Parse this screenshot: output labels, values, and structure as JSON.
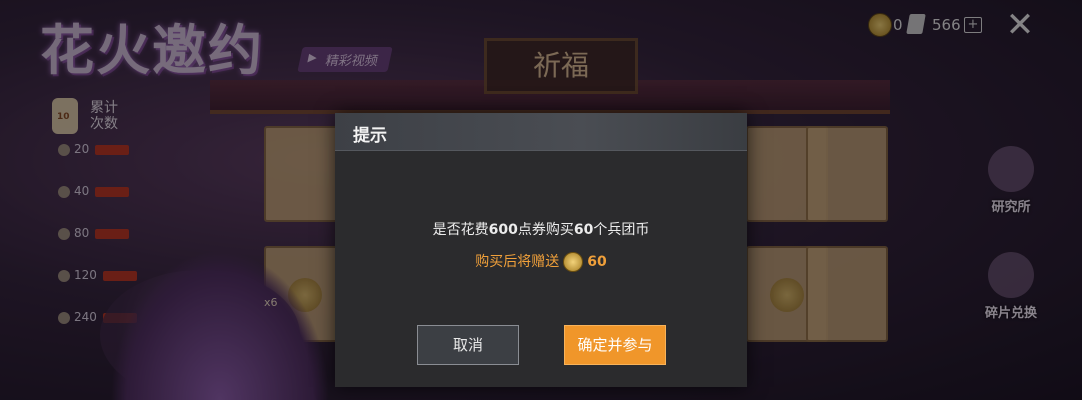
{
  "background": {
    "event_title": "花火邀约",
    "video_tag": "精彩视频",
    "shrine_sign": "祈福",
    "cumulative_label": "累计\n次数",
    "lantern_count": "10",
    "milestones": [
      "20",
      "40",
      "80",
      "120",
      "240"
    ],
    "tile_badge": "x6",
    "side_items": [
      {
        "label": "研究所"
      },
      {
        "label": "碎片兑换"
      }
    ]
  },
  "topbar": {
    "coupon_count": "0",
    "ticket_count": "566",
    "plus_symbol": "+",
    "close_symbol": "✕"
  },
  "dialog": {
    "title": "提示",
    "message_prefix": "是否花费",
    "message_amount": "600",
    "message_mid": "点券购买",
    "message_qty": "60",
    "message_suffix": "个兵团币",
    "gift_text": "购买后将赠送",
    "gift_amount": "60",
    "cancel_label": "取消",
    "confirm_label": "确定并参与"
  },
  "colors": {
    "confirm": "#f0962a",
    "gift_text": "#f0a03a",
    "dialog_bg": "#2b2b2d"
  }
}
